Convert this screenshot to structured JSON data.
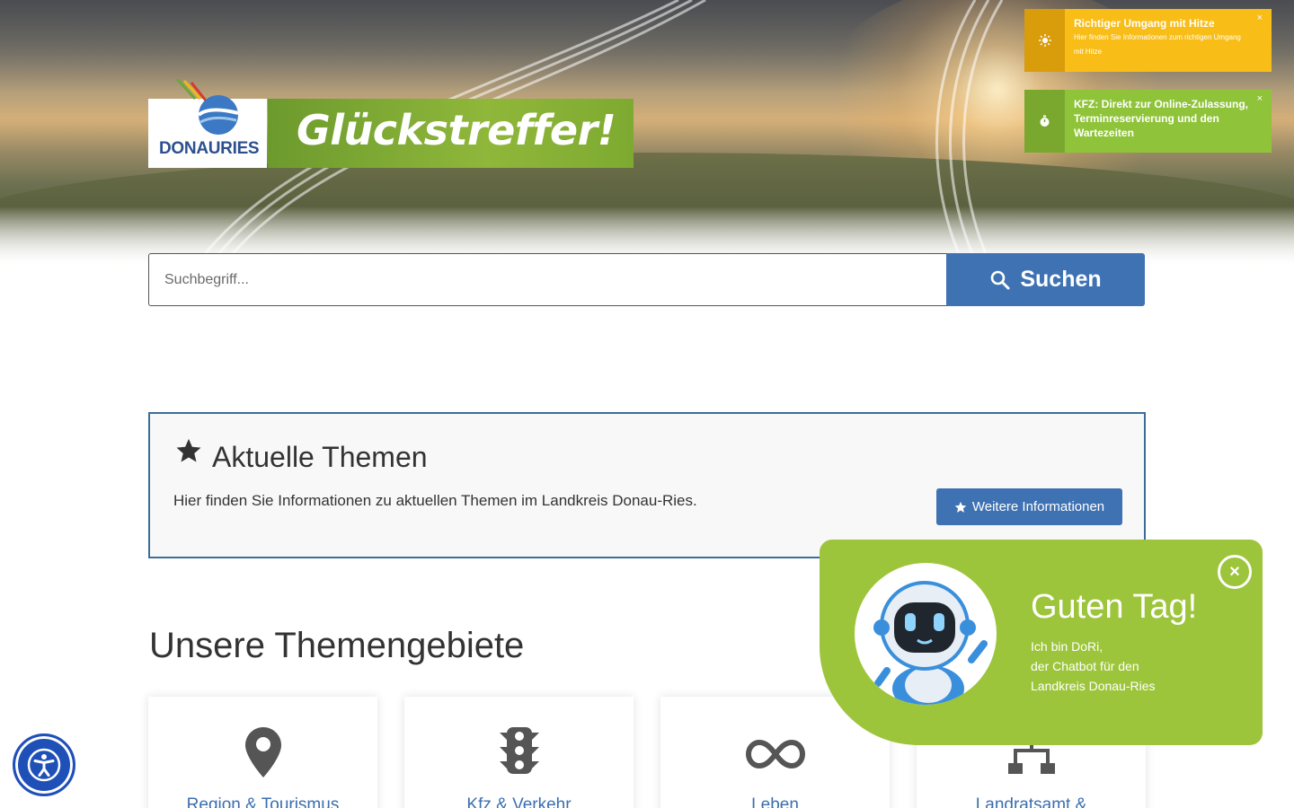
{
  "logo": {
    "text": "DONAURIES",
    "slogan": "Glückstreffer!"
  },
  "notifications": [
    {
      "icon": "sun-icon",
      "title": "Richtiger Umgang mit Hitze",
      "text": "Hier finden Sie Informationen zum richtigen Umgang mit Hitze",
      "close": "×",
      "color": "#f9bd17"
    },
    {
      "icon": "stopwatch-icon",
      "title": "KFZ: Direkt zur Online-Zulassung, Terminreservierung und den Wartezeiten",
      "text": "",
      "close": "×",
      "color": "#8fc43a"
    }
  ],
  "search": {
    "placeholder": "Suchbegriff...",
    "button_label": "Suchen",
    "icon": "search-icon"
  },
  "topics": {
    "icon": "star-icon",
    "title": "Aktuelle Themen",
    "description": "Hier finden Sie Informationen zu aktuellen Themen im Landkreis Donau-Ries.",
    "button_label": "Weitere Informationen"
  },
  "themen": {
    "title": "Unsere Themengebiete",
    "cards": [
      {
        "label": "Region & Tourismus",
        "icon": "map-pin-icon"
      },
      {
        "label": "Kfz & Verkehr",
        "icon": "traffic-light-icon"
      },
      {
        "label": "Leben",
        "icon": "infinity-icon"
      },
      {
        "label": "Landratsamt &",
        "icon": "sitemap-icon"
      }
    ]
  },
  "chatbot": {
    "greeting": "Guten Tag!",
    "line1": "Ich bin DoRi,",
    "line2": "der Chatbot für den",
    "line3": "Landkreis Donau-Ries",
    "close": "×",
    "color": "#9dc53b"
  },
  "accessibility": {
    "icon": "accessibility-icon"
  },
  "colors": {
    "primary": "#3e72b3",
    "green": "#8fb73a",
    "yellow": "#f9bd17"
  }
}
